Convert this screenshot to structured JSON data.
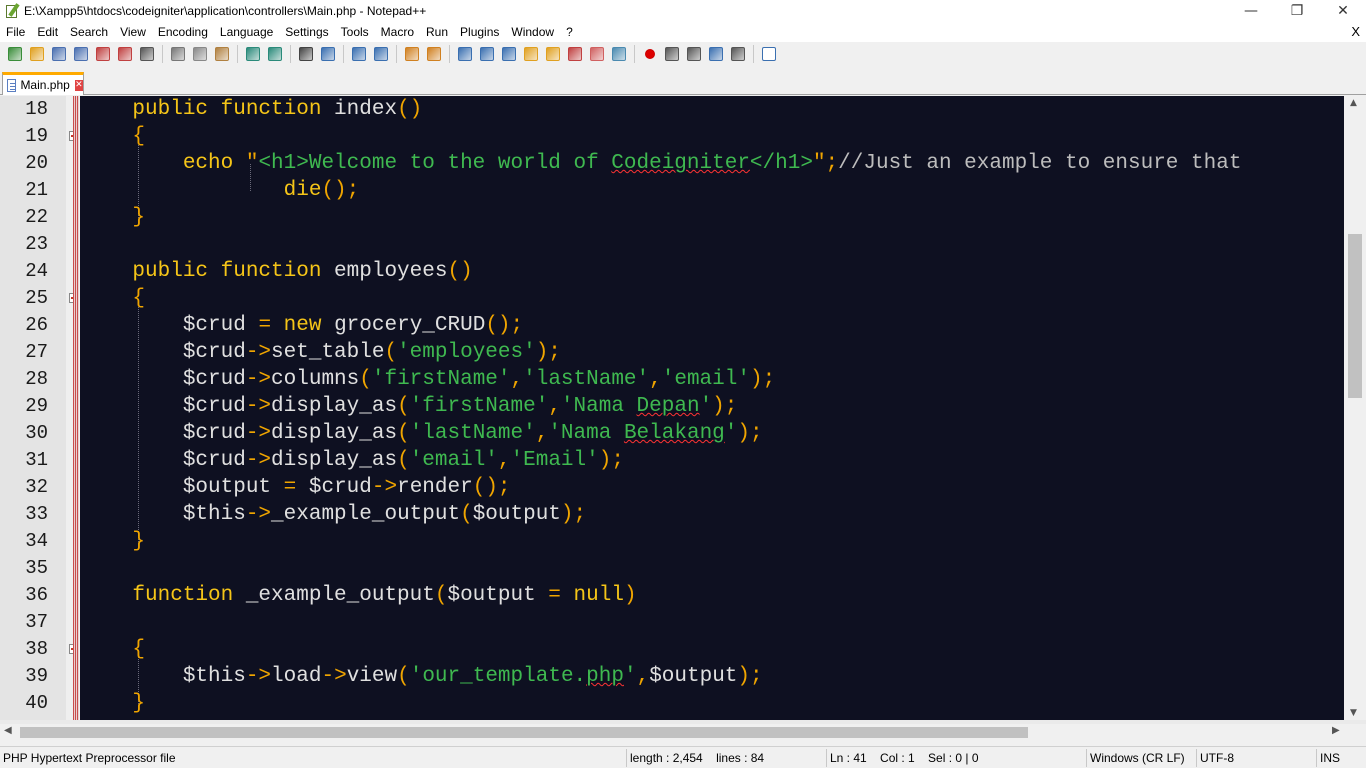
{
  "window": {
    "title": "E:\\Xampp5\\htdocs\\codeigniter\\application\\controllers\\Main.php - Notepad++",
    "minimize": "—",
    "restore": "❐",
    "close": "✕"
  },
  "menu": [
    "File",
    "Edit",
    "Search",
    "View",
    "Encoding",
    "Language",
    "Settings",
    "Tools",
    "Macro",
    "Run",
    "Plugins",
    "Window",
    "?"
  ],
  "menu_close_doc": "X",
  "toolbar_icons": [
    "new-file-icon",
    "open-file-icon",
    "save-icon",
    "save-all-icon",
    "close-icon",
    "close-all-icon",
    "print-icon",
    "cut-icon",
    "copy-icon",
    "paste-icon",
    "undo-icon",
    "redo-icon",
    "find-icon",
    "replace-icon",
    "zoom-in-icon",
    "zoom-out-icon",
    "sync-v-icon",
    "sync-h-icon",
    "word-wrap-icon",
    "show-all-chars-icon",
    "indent-guide-icon",
    "doc-map-icon",
    "function-list-icon",
    "folder-workspace-icon",
    "doc-switcher-icon",
    "monitor-icon",
    "record-macro-icon",
    "stop-record-icon",
    "play-macro-icon",
    "run-macro-multiple-icon",
    "save-macro-icon",
    "spell-check-icon"
  ],
  "tab": {
    "label": "Main.php",
    "close": "✕"
  },
  "line_numbers": [
    "18",
    "19",
    "20",
    "21",
    "22",
    "23",
    "24",
    "25",
    "26",
    "27",
    "28",
    "29",
    "30",
    "31",
    "32",
    "33",
    "34",
    "35",
    "36",
    "37",
    "38",
    "39",
    "40"
  ],
  "code_lines": [
    [
      [
        "kw",
        "    public function "
      ],
      [
        "fn",
        "index"
      ],
      [
        "op",
        "()"
      ]
    ],
    [
      [
        "op",
        "    {"
      ]
    ],
    [
      [
        "kw",
        "        echo "
      ],
      [
        "op",
        "\""
      ],
      [
        "str",
        "<h1>Welcome to the world of "
      ],
      [
        "str",
        "Codeigniter",
        "squig"
      ],
      [
        "str",
        "</h1>"
      ],
      [
        "op",
        "\";"
      ],
      [
        "cm",
        "//Just an example to ensure that"
      ]
    ],
    [
      [
        "kw",
        "                die"
      ],
      [
        "op",
        "();"
      ]
    ],
    [
      [
        "op",
        "    }"
      ]
    ],
    [
      [
        "fn",
        ""
      ]
    ],
    [
      [
        "kw",
        "    public function "
      ],
      [
        "fn",
        "employees"
      ],
      [
        "op",
        "()"
      ]
    ],
    [
      [
        "op",
        "    {"
      ]
    ],
    [
      [
        "var",
        "        $crud "
      ],
      [
        "op",
        "= "
      ],
      [
        "kw",
        "new "
      ],
      [
        "fn",
        "grocery_CRUD"
      ],
      [
        "op",
        "();"
      ]
    ],
    [
      [
        "var",
        "        $crud"
      ],
      [
        "op",
        "->"
      ],
      [
        "fn",
        "set_table"
      ],
      [
        "op",
        "("
      ],
      [
        "str",
        "'employees'"
      ],
      [
        "op",
        ");"
      ]
    ],
    [
      [
        "var",
        "        $crud"
      ],
      [
        "op",
        "->"
      ],
      [
        "fn",
        "columns"
      ],
      [
        "op",
        "("
      ],
      [
        "str",
        "'firstName'"
      ],
      [
        "op",
        ","
      ],
      [
        "str",
        "'lastName'"
      ],
      [
        "op",
        ","
      ],
      [
        "str",
        "'email'"
      ],
      [
        "op",
        ");"
      ]
    ],
    [
      [
        "var",
        "        $crud"
      ],
      [
        "op",
        "->"
      ],
      [
        "fn",
        "display_as"
      ],
      [
        "op",
        "("
      ],
      [
        "str",
        "'firstName'"
      ],
      [
        "op",
        ","
      ],
      [
        "str",
        "'Nama "
      ],
      [
        "str",
        "Depan",
        "squig"
      ],
      [
        "str",
        "'"
      ],
      [
        "op",
        ");"
      ]
    ],
    [
      [
        "var",
        "        $crud"
      ],
      [
        "op",
        "->"
      ],
      [
        "fn",
        "display_as"
      ],
      [
        "op",
        "("
      ],
      [
        "str",
        "'lastName'"
      ],
      [
        "op",
        ","
      ],
      [
        "str",
        "'Nama "
      ],
      [
        "str",
        "Belakang",
        "squig"
      ],
      [
        "str",
        "'"
      ],
      [
        "op",
        ");"
      ]
    ],
    [
      [
        "var",
        "        $crud"
      ],
      [
        "op",
        "->"
      ],
      [
        "fn",
        "display_as"
      ],
      [
        "op",
        "("
      ],
      [
        "str",
        "'email'"
      ],
      [
        "op",
        ","
      ],
      [
        "str",
        "'Email'"
      ],
      [
        "op",
        ");"
      ]
    ],
    [
      [
        "var",
        "        $output "
      ],
      [
        "op",
        "= "
      ],
      [
        "var",
        "$crud"
      ],
      [
        "op",
        "->"
      ],
      [
        "fn",
        "render"
      ],
      [
        "op",
        "();"
      ]
    ],
    [
      [
        "var",
        "        $this"
      ],
      [
        "op",
        "->"
      ],
      [
        "fn",
        "_example_output"
      ],
      [
        "op",
        "("
      ],
      [
        "var",
        "$output"
      ],
      [
        "op",
        ");"
      ]
    ],
    [
      [
        "op",
        "    }"
      ]
    ],
    [
      [
        "fn",
        ""
      ]
    ],
    [
      [
        "kw",
        "    function "
      ],
      [
        "fn",
        "_example_output"
      ],
      [
        "op",
        "("
      ],
      [
        "var",
        "$output "
      ],
      [
        "op",
        "= "
      ],
      [
        "kw",
        "null"
      ],
      [
        "op",
        ")"
      ]
    ],
    [
      [
        "fn",
        ""
      ]
    ],
    [
      [
        "op",
        "    {"
      ]
    ],
    [
      [
        "var",
        "        $this"
      ],
      [
        "op",
        "->"
      ],
      [
        "fn",
        "load"
      ],
      [
        "op",
        "->"
      ],
      [
        "fn",
        "view"
      ],
      [
        "op",
        "("
      ],
      [
        "str",
        "'our_template."
      ],
      [
        "str",
        "php",
        "squig"
      ],
      [
        "str",
        "'"
      ],
      [
        "op",
        ","
      ],
      [
        "var",
        "$output"
      ],
      [
        "op",
        ");"
      ]
    ],
    [
      [
        "op",
        "    }"
      ]
    ]
  ],
  "status": {
    "file_type": "PHP Hypertext Preprocessor file",
    "length_lines": "length : 2,454    lines : 84",
    "position": "Ln : 41    Col : 1    Sel : 0 | 0",
    "eol": "Windows (CR LF)",
    "encoding": "UTF-8",
    "mode": "INS"
  },
  "colors": {
    "editor_bg": "#0e1021",
    "keyword": "#f5c518",
    "string": "#3fb950",
    "operator": "#f0a500",
    "tab_accent": "#ffaa00"
  }
}
